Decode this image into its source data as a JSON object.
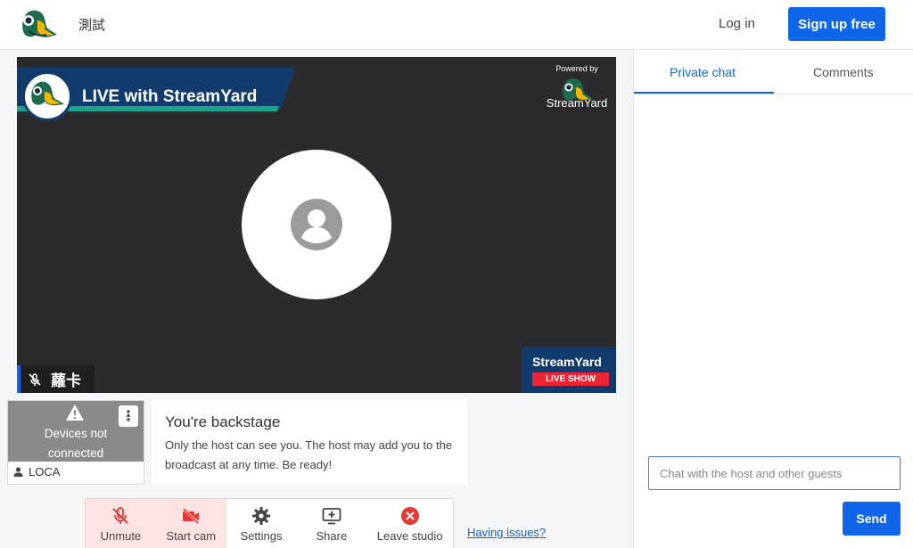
{
  "header": {
    "studio_name": "測試",
    "login_label": "Log in",
    "signup_label": "Sign up free"
  },
  "stage": {
    "banner_title": "LIVE with StreamYard",
    "powered_label": "Powered by",
    "powered_brand": "StreamYard",
    "participant_name": "蘿卡",
    "badge_brand": "StreamYard",
    "badge_live": "LIVE SHOW"
  },
  "tile": {
    "status_line1": "Devices not",
    "status_line2": "connected",
    "menu_glyph": "⋮",
    "name": "LOCA"
  },
  "backstage": {
    "heading": "You're backstage",
    "description": "Only the host can see you. The host may add you to the broadcast at any time. Be ready!"
  },
  "controls": [
    {
      "label": "Unmute",
      "icon": "mic-off-icon",
      "state": "alert"
    },
    {
      "label": "Start cam",
      "icon": "camera-off-icon",
      "state": "alert"
    },
    {
      "label": "Settings",
      "icon": "gear-icon",
      "state": "normal"
    },
    {
      "label": "Share",
      "icon": "screen-share-icon",
      "state": "normal"
    },
    {
      "label": "Leave studio",
      "icon": "close-circle-icon",
      "state": "danger"
    }
  ],
  "issues_link": "Having issues?",
  "sidebar": {
    "tabs": [
      {
        "label": "Private chat",
        "active": true
      },
      {
        "label": "Comments",
        "active": false
      }
    ],
    "chat_placeholder": "Chat with the host and other guests",
    "send_label": "Send"
  },
  "colors": {
    "brand_blue": "#0f66e9",
    "danger_red": "#e53935",
    "alert_bg": "#fde3e1",
    "stage_bg": "#2b2b2d",
    "banner_navy": "#113b6c",
    "banner_teal": "#1aa38a"
  }
}
